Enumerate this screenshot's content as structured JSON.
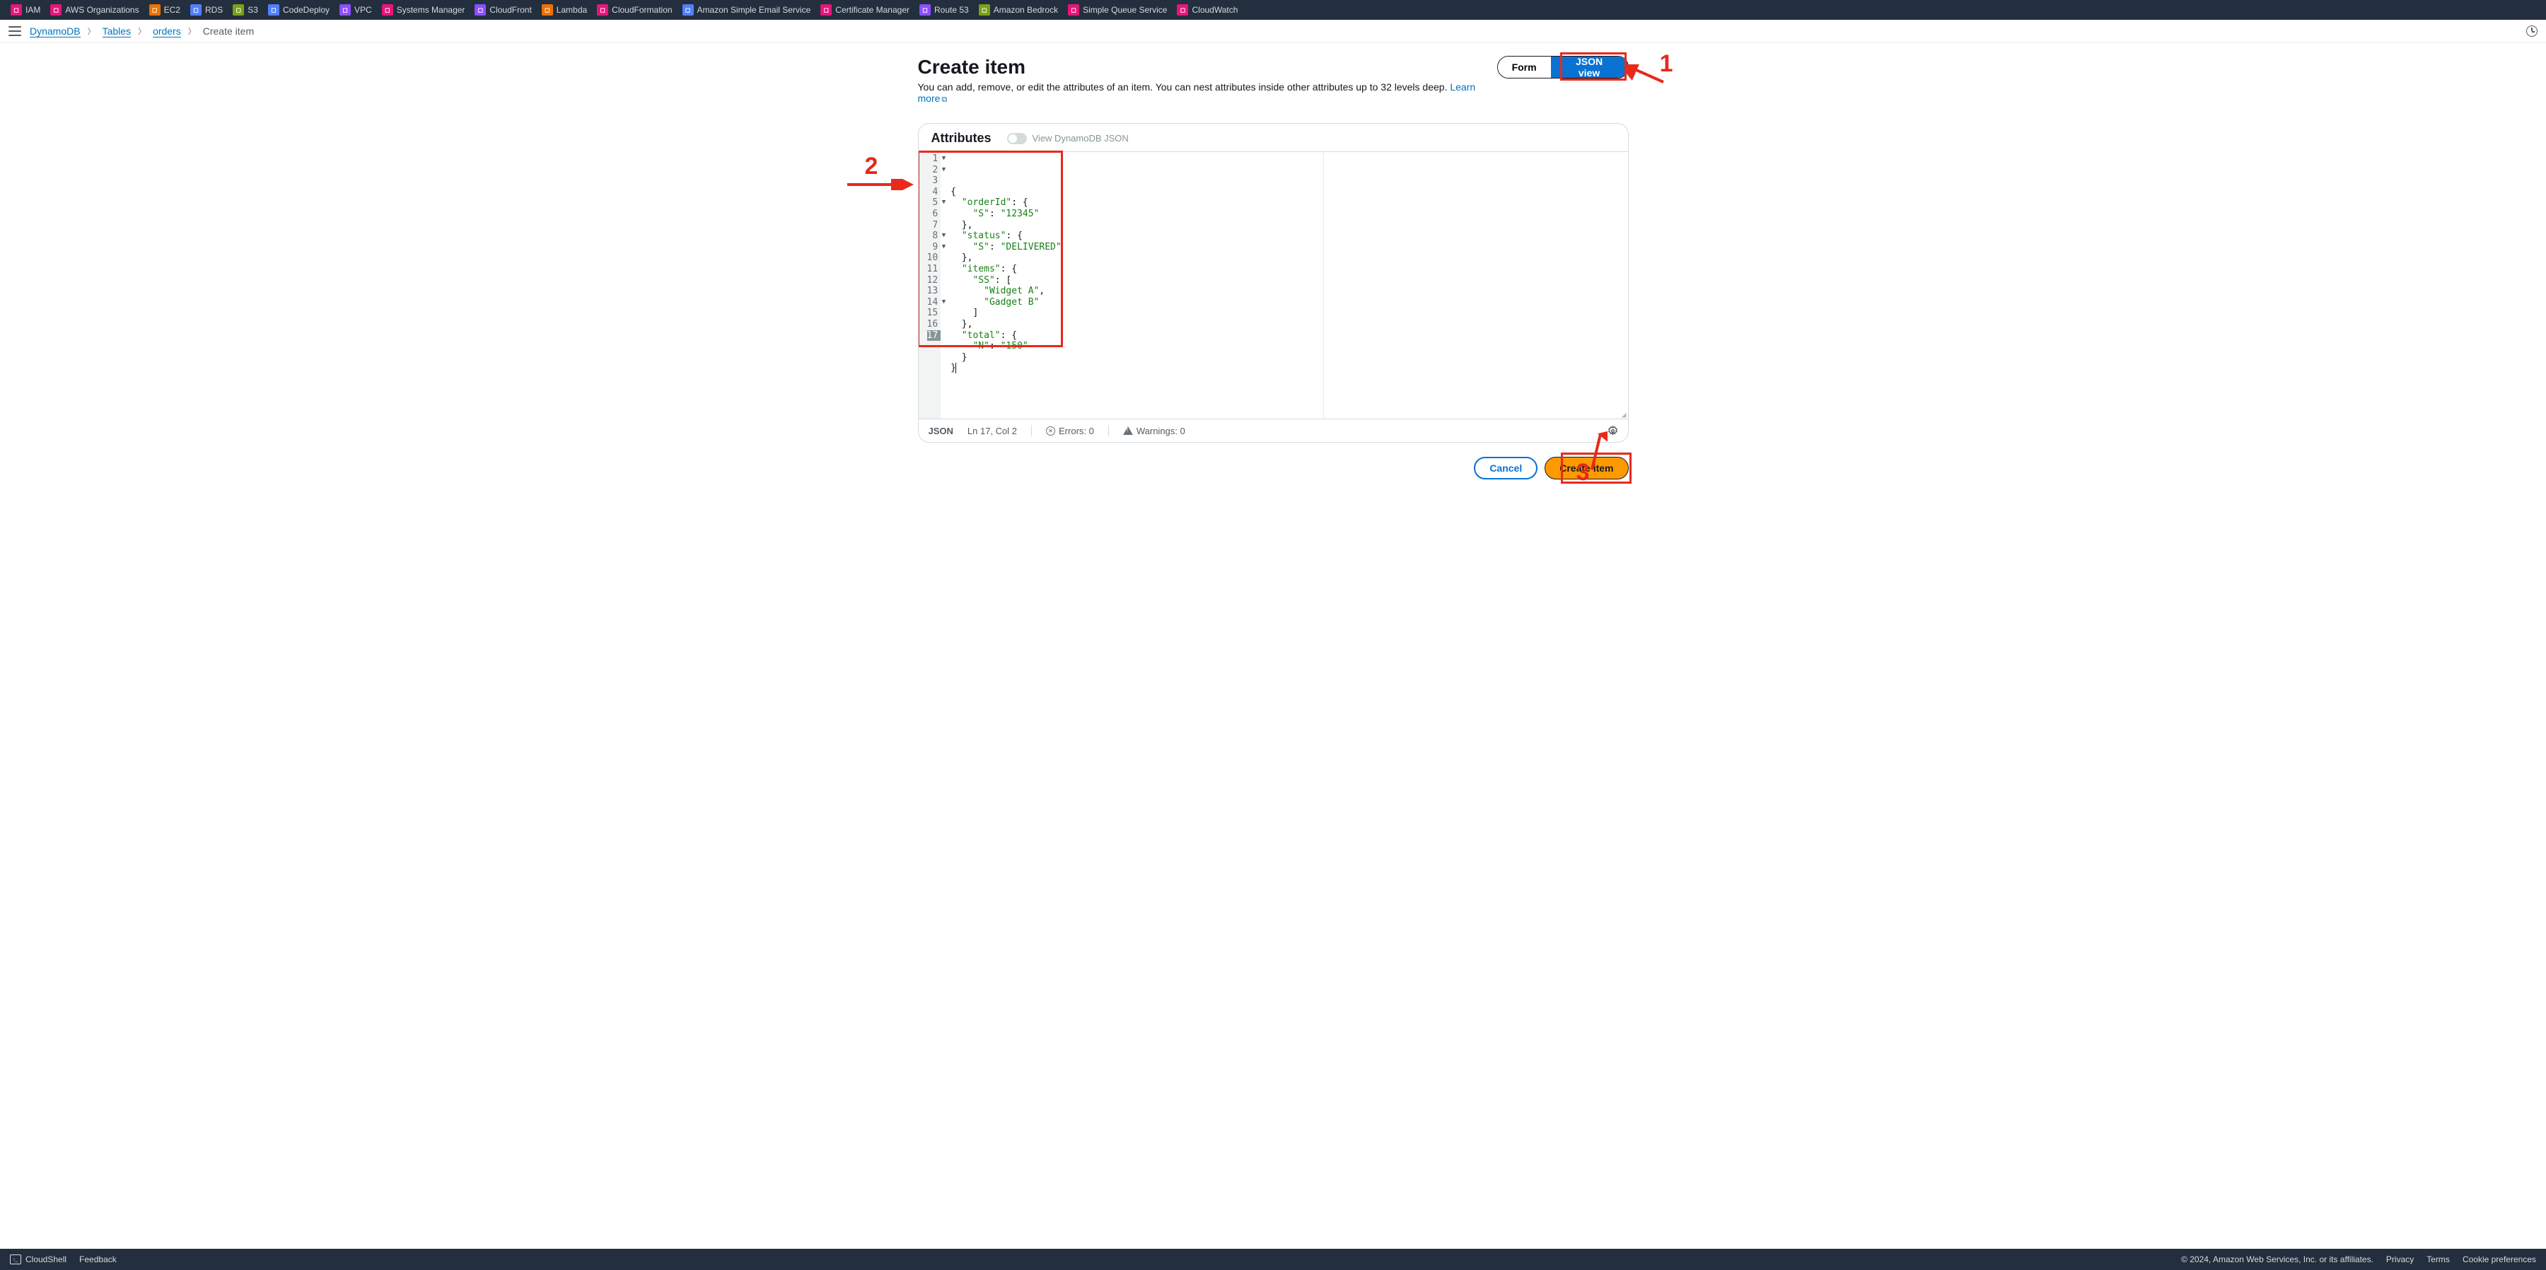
{
  "services": [
    {
      "name": "IAM",
      "color": "#e7157b"
    },
    {
      "name": "AWS Organizations",
      "color": "#e7157b"
    },
    {
      "name": "EC2",
      "color": "#ed7100"
    },
    {
      "name": "RDS",
      "color": "#527fff"
    },
    {
      "name": "S3",
      "color": "#7aa116"
    },
    {
      "name": "CodeDeploy",
      "color": "#527fff"
    },
    {
      "name": "VPC",
      "color": "#8c4fff"
    },
    {
      "name": "Systems Manager",
      "color": "#e7157b"
    },
    {
      "name": "CloudFront",
      "color": "#8c4fff"
    },
    {
      "name": "Lambda",
      "color": "#ed7100"
    },
    {
      "name": "CloudFormation",
      "color": "#e7157b"
    },
    {
      "name": "Amazon Simple Email Service",
      "color": "#527fff"
    },
    {
      "name": "Certificate Manager",
      "color": "#e7157b"
    },
    {
      "name": "Route 53",
      "color": "#8c4fff"
    },
    {
      "name": "Amazon Bedrock",
      "color": "#7aa116"
    },
    {
      "name": "Simple Queue Service",
      "color": "#e7157b"
    },
    {
      "name": "CloudWatch",
      "color": "#e7157b"
    }
  ],
  "breadcrumb": {
    "root": "DynamoDB",
    "l1": "Tables",
    "l2": "orders",
    "current": "Create item"
  },
  "page": {
    "title": "Create item",
    "description": "You can add, remove, or edit the attributes of an item. You can nest attributes inside other attributes up to 32 levels deep. ",
    "learn_more": "Learn more"
  },
  "toggle": {
    "form": "Form",
    "json": "JSON view"
  },
  "panel": {
    "title": "Attributes",
    "ddb_toggle": "View DynamoDB JSON"
  },
  "code_lines": [
    {
      "n": "1",
      "fold": true,
      "t": [
        "{"
      ]
    },
    {
      "n": "2",
      "fold": true,
      "t": [
        "  ",
        "\"orderId\"",
        ": {"
      ]
    },
    {
      "n": "3",
      "fold": false,
      "t": [
        "    ",
        "\"S\"",
        ": ",
        "\"12345\""
      ]
    },
    {
      "n": "4",
      "fold": false,
      "t": [
        "  },"
      ]
    },
    {
      "n": "5",
      "fold": true,
      "t": [
        "  ",
        "\"status\"",
        ": {"
      ]
    },
    {
      "n": "6",
      "fold": false,
      "t": [
        "    ",
        "\"S\"",
        ": ",
        "\"DELIVERED\""
      ]
    },
    {
      "n": "7",
      "fold": false,
      "t": [
        "  },"
      ]
    },
    {
      "n": "8",
      "fold": true,
      "t": [
        "  ",
        "\"items\"",
        ": {"
      ]
    },
    {
      "n": "9",
      "fold": true,
      "t": [
        "    ",
        "\"SS\"",
        ": ["
      ]
    },
    {
      "n": "10",
      "fold": false,
      "t": [
        "      ",
        "\"Widget A\"",
        ","
      ]
    },
    {
      "n": "11",
      "fold": false,
      "t": [
        "      ",
        "\"Gadget B\""
      ]
    },
    {
      "n": "12",
      "fold": false,
      "t": [
        "    ]"
      ]
    },
    {
      "n": "13",
      "fold": false,
      "t": [
        "  },"
      ]
    },
    {
      "n": "14",
      "fold": true,
      "t": [
        "  ",
        "\"total\"",
        ": {"
      ]
    },
    {
      "n": "15",
      "fold": false,
      "t": [
        "    ",
        "\"N\"",
        ": ",
        "\"150\""
      ]
    },
    {
      "n": "16",
      "fold": false,
      "t": [
        "  }"
      ]
    },
    {
      "n": "17",
      "fold": false,
      "t": [
        "}"
      ]
    }
  ],
  "status": {
    "mode": "JSON",
    "pos": "Ln 17, Col 2",
    "errors": "Errors: 0",
    "warnings": "Warnings: 0"
  },
  "actions": {
    "cancel": "Cancel",
    "create": "Create item"
  },
  "footer": {
    "cloudshell": "CloudShell",
    "feedback": "Feedback",
    "copyright": "© 2024, Amazon Web Services, Inc. or its affiliates.",
    "privacy": "Privacy",
    "terms": "Terms",
    "cookies": "Cookie preferences"
  },
  "annotations": {
    "n1": "1",
    "n2": "2",
    "n3": "3"
  }
}
